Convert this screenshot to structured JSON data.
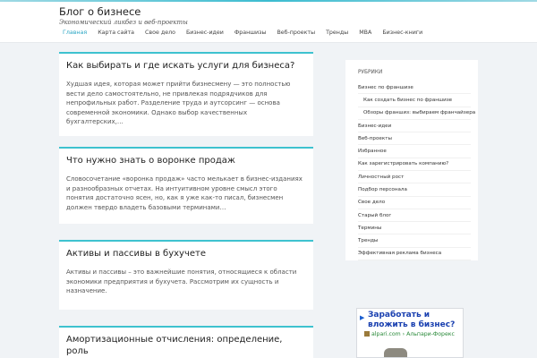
{
  "site": {
    "title": "Блог о бизнесе",
    "description": "Экономический ликбез и веб-проекты"
  },
  "nav": {
    "items": [
      "Главная",
      "Карта сайта",
      "Свое дело",
      "Бизнес-идеи",
      "Франшизы",
      "Веб-проекты",
      "Тренды",
      "MBA",
      "Бизнес-книги"
    ]
  },
  "posts": [
    {
      "title": "Как выбирать и где искать услуги для бизнеса?",
      "excerpt": "Худшая идея, которая может прийти бизнесмену — это полностью вести дело самостоятельно, не привлекая подрядчиков для непрофильных работ. Разделение труда и аутсорсинг — основа современной экономики. Однако выбор качественных бухгалтерских,…"
    },
    {
      "title": "Что нужно знать о воронке продаж",
      "excerpt": "Словосочетание «воронка продаж» часто мелькает в бизнес-изданиях и разнообразных отчетах. На интуитивном уровне смысл этого понятия достаточно ясен, но, как я уже как-то писал, бизнесмен должен твердо владеть базовыми терминами…"
    },
    {
      "title": "Активы и пассивы в бухучете",
      "excerpt": "Активы и пассивы – это важнейшие понятия, относящиеся к области экономики предприятия и бухучета. Рассмотрим их сущность и назначение."
    },
    {
      "title": "Амортизационные отчисления: определение, роль",
      "excerpt": ""
    }
  ],
  "sidebar": {
    "title": "РУБРИКИ",
    "categories": [
      {
        "label": "Бизнес по франшизе",
        "sub": false
      },
      {
        "label": "Как создать бизнес по франшизе",
        "sub": true
      },
      {
        "label": "Обзоры франшиз: выбираем франчайзера",
        "sub": true
      },
      {
        "label": "Бизнес-идеи",
        "sub": false
      },
      {
        "label": "Веб-проекты",
        "sub": false
      },
      {
        "label": "Избранное",
        "sub": false
      },
      {
        "label": "Как зарегистрировать компанию?",
        "sub": false
      },
      {
        "label": "Личностный рост",
        "sub": false
      },
      {
        "label": "Подбор персонала",
        "sub": false
      },
      {
        "label": "Свое дело",
        "sub": false
      },
      {
        "label": "Старый блог",
        "sub": false
      },
      {
        "label": "Термины",
        "sub": false
      },
      {
        "label": "Тренды",
        "sub": false
      },
      {
        "label": "Эффективная реклама бизнеса",
        "sub": false
      }
    ]
  },
  "ad": {
    "headline": "Заработать и вложить в бизнес?",
    "source": "alpari.com › Альпари-Форекс",
    "arrow_icon": "play-arrow-icon"
  },
  "colors": {
    "accent": "#3ec2cf",
    "nav_active": "#2ba6c4",
    "background": "#f0f3f6"
  }
}
